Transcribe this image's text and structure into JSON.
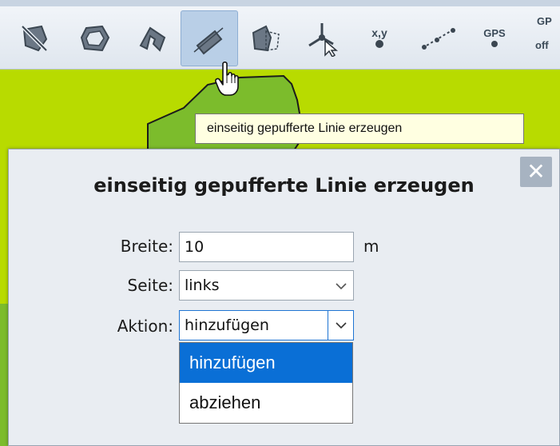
{
  "colors": {
    "map_background": "#b8db00",
    "polygon_fill": "#7cbc2c",
    "selection_blue": "#0a6fd6"
  },
  "toolbar": {
    "tools": [
      {
        "icon": "no-polygon-icon"
      },
      {
        "icon": "polygon-draw-icon"
      },
      {
        "icon": "polygon-buffer-icon"
      },
      {
        "icon": "line-buffer-icon",
        "active": true
      },
      {
        "icon": "polygon-split-icon"
      },
      {
        "icon": "vertex-move-icon"
      },
      {
        "icon": "xy-point-icon",
        "text": "x,y"
      },
      {
        "icon": "gps-line-icon"
      },
      {
        "icon": "gps-point-icon",
        "text": "GPS"
      },
      {
        "icon": "gps-off-icon",
        "text": "GP",
        "text2": "off"
      }
    ]
  },
  "tooltip": {
    "text": "einseitig gepufferte Linie erzeugen"
  },
  "dialog": {
    "close_label": "✕",
    "title": "einseitig gepufferte Linie erzeugen",
    "width_label": "Breite:",
    "width_value": "10",
    "width_unit": "m",
    "side_label": "Seite:",
    "side_value": "links",
    "action_label": "Aktion:",
    "action_value": "hinzufügen",
    "action_options": [
      "hinzufügen",
      "abziehen"
    ]
  }
}
